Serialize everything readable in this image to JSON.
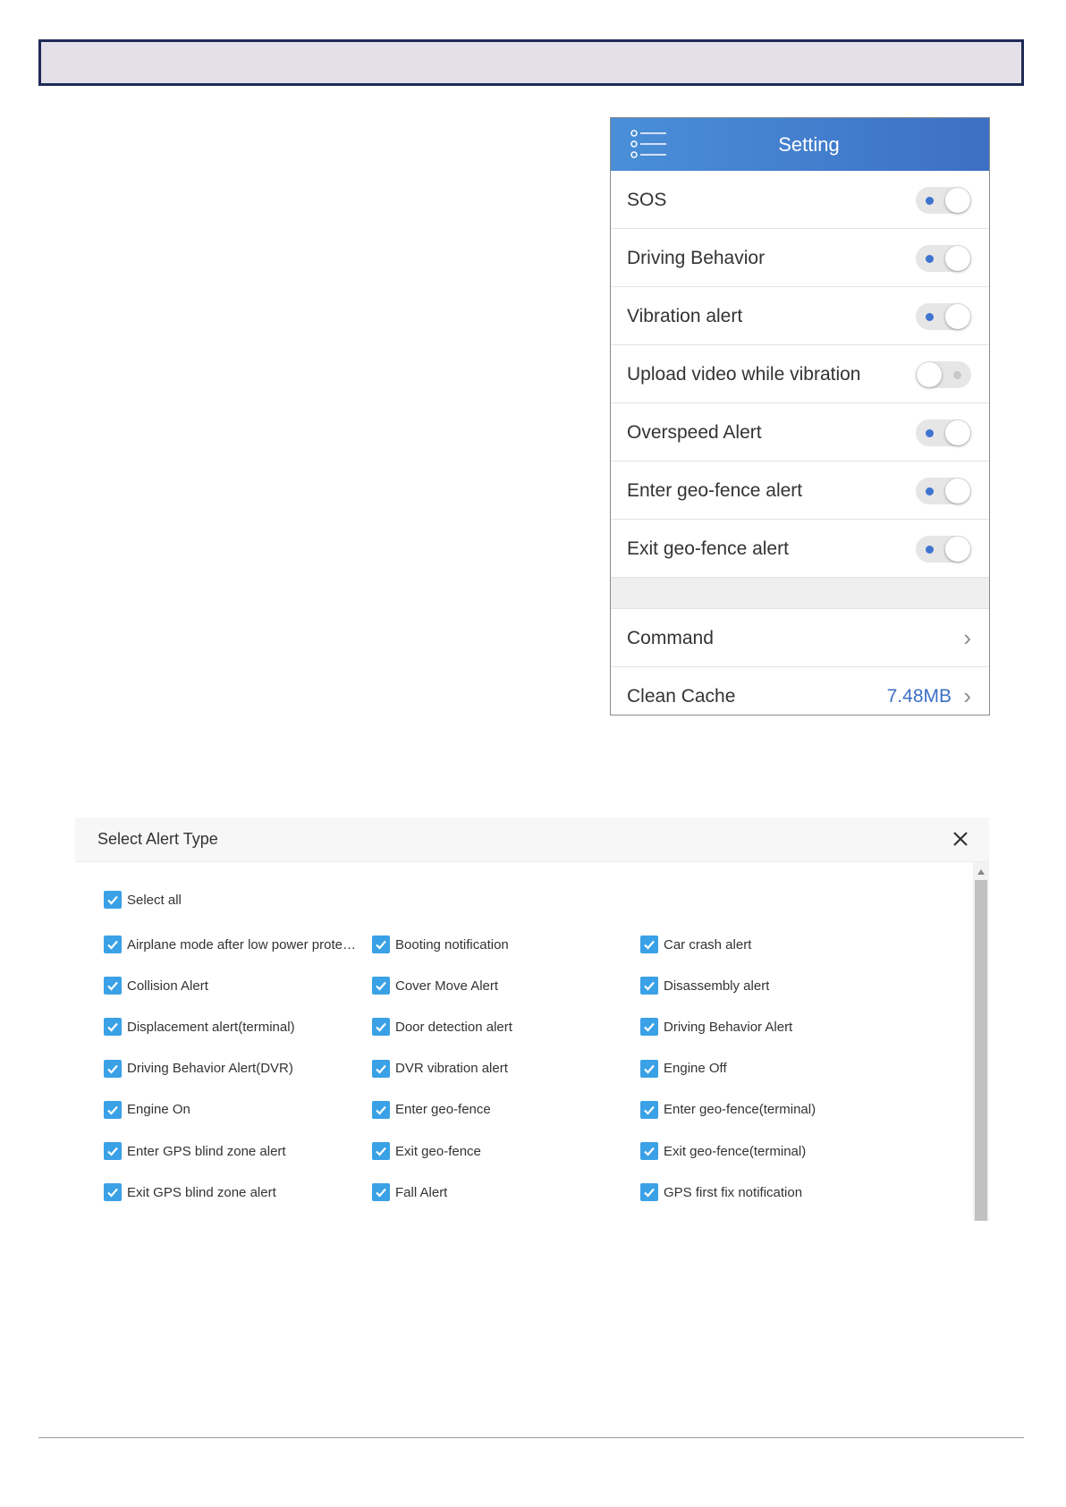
{
  "colors": {
    "header_start": "#4a8fd8",
    "header_end": "#3d6fc4",
    "toggle_on_dot": "#3f74cf",
    "checkbox": "#3aa1e6",
    "cache_value": "#3d6fc4",
    "banner_border": "#1f2a55"
  },
  "setting": {
    "title": "Setting",
    "menu_icon": "list-menu-icon",
    "toggles": [
      {
        "label": "SOS",
        "on": true
      },
      {
        "label": "Driving Behavior",
        "on": true
      },
      {
        "label": "Vibration alert",
        "on": true
      },
      {
        "label": "Upload video while vibration",
        "on": false
      },
      {
        "label": "Overspeed Alert",
        "on": true
      },
      {
        "label": "Enter geo-fence alert",
        "on": true
      },
      {
        "label": "Exit geo-fence alert",
        "on": true
      }
    ],
    "command_label": "Command",
    "clean_cache_label": "Clean Cache",
    "clean_cache_value": "7.48MB"
  },
  "alert_dialog": {
    "title": "Select Alert Type",
    "select_all": "Select all",
    "items": [
      "Airplane mode after low power prote…",
      "Booting notification",
      "Car crash alert",
      "Collision Alert",
      "Cover Move Alert",
      "Disassembly alert",
      "Displacement alert(terminal)",
      "Door detection alert",
      "Driving Behavior Alert",
      "Driving Behavior Alert(DVR)",
      "DVR vibration alert",
      "Engine Off",
      "Engine On",
      "Enter geo-fence",
      "Enter geo-fence(terminal)",
      "Enter GPS blind zone alert",
      "Exit geo-fence",
      "Exit geo-fence(terminal)",
      "Exit GPS blind zone alert",
      "Fall Alert",
      "GPS first fix notification"
    ]
  }
}
